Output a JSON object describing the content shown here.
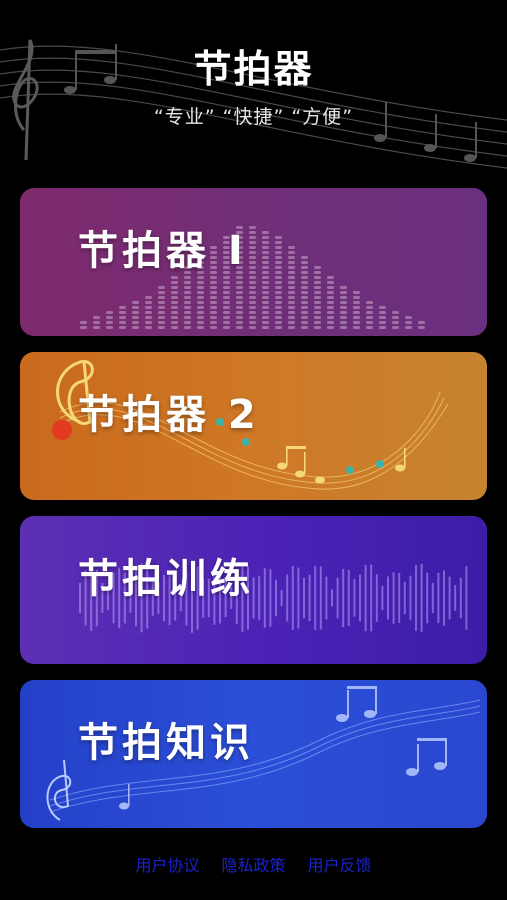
{
  "header": {
    "title": "节拍器",
    "subtitle": "“专业” “快捷” “方便”"
  },
  "cards": [
    {
      "label": "节拍器 I"
    },
    {
      "label": "节拍器 2"
    },
    {
      "label": "节拍训练"
    },
    {
      "label": "节拍知识"
    }
  ],
  "footer": {
    "links": [
      "用户协议",
      "隐私政策",
      "用户反馈"
    ]
  },
  "colors": {
    "card1": "#7f2a6e",
    "card2": "#c96a1c",
    "card3": "#4a22b6",
    "card4": "#2a47cf",
    "footer_link": "#1a22c8"
  }
}
